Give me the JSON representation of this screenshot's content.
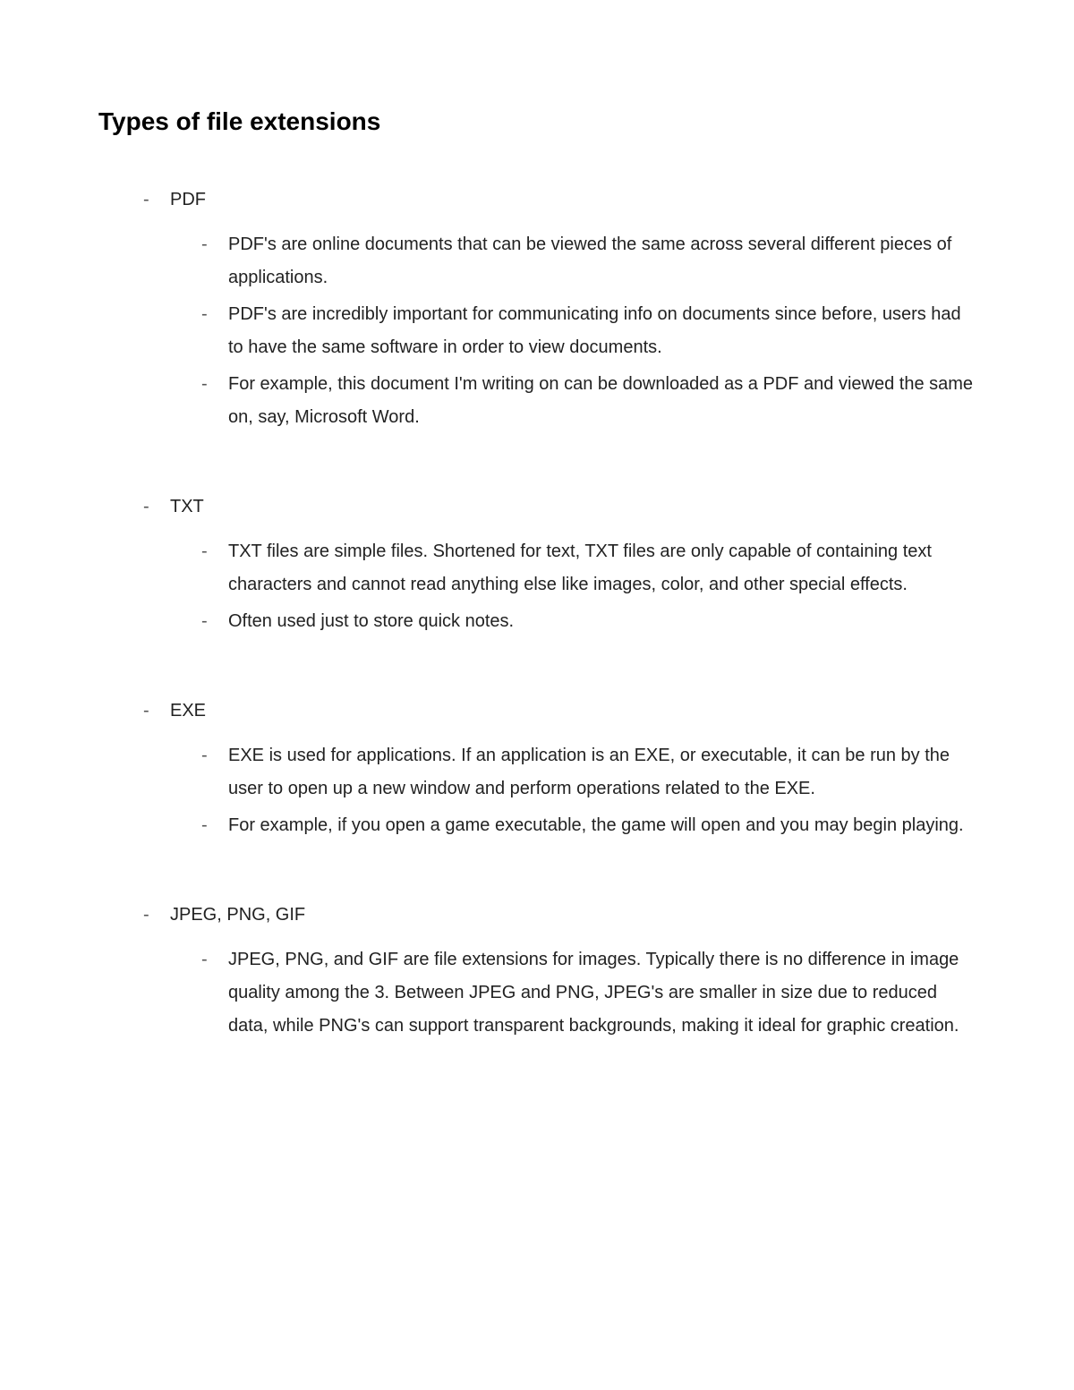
{
  "title": "Types of file extensions",
  "sections": [
    {
      "heading": "PDF",
      "points": [
        "PDF's are online documents that can be viewed the same across several different pieces of applications.",
        "PDF's are incredibly important for communicating info on documents since before, users had to have the same software in order to view documents.",
        "For example, this document I'm writing on can be downloaded as a PDF and viewed the same on, say, Microsoft Word."
      ]
    },
    {
      "heading": "TXT",
      "points": [
        "TXT files are simple files. Shortened for text, TXT files are only capable of containing text characters and cannot read anything else like images, color, and other special effects.",
        "Often used just to store quick notes."
      ]
    },
    {
      "heading": "EXE",
      "points": [
        "EXE is used for applications. If an application is an EXE, or executable, it can be run by the user to open up a new window and perform operations related to the EXE.",
        "For example, if you open a game executable, the game will open and you may begin playing."
      ]
    },
    {
      "heading": "JPEG, PNG, GIF",
      "points": [
        "JPEG, PNG, and GIF are file extensions for images. Typically there is no difference in image quality among the 3. Between JPEG and PNG, JPEG's are smaller in size due to reduced data, while PNG's can support transparent backgrounds, making it ideal for graphic creation."
      ]
    }
  ]
}
